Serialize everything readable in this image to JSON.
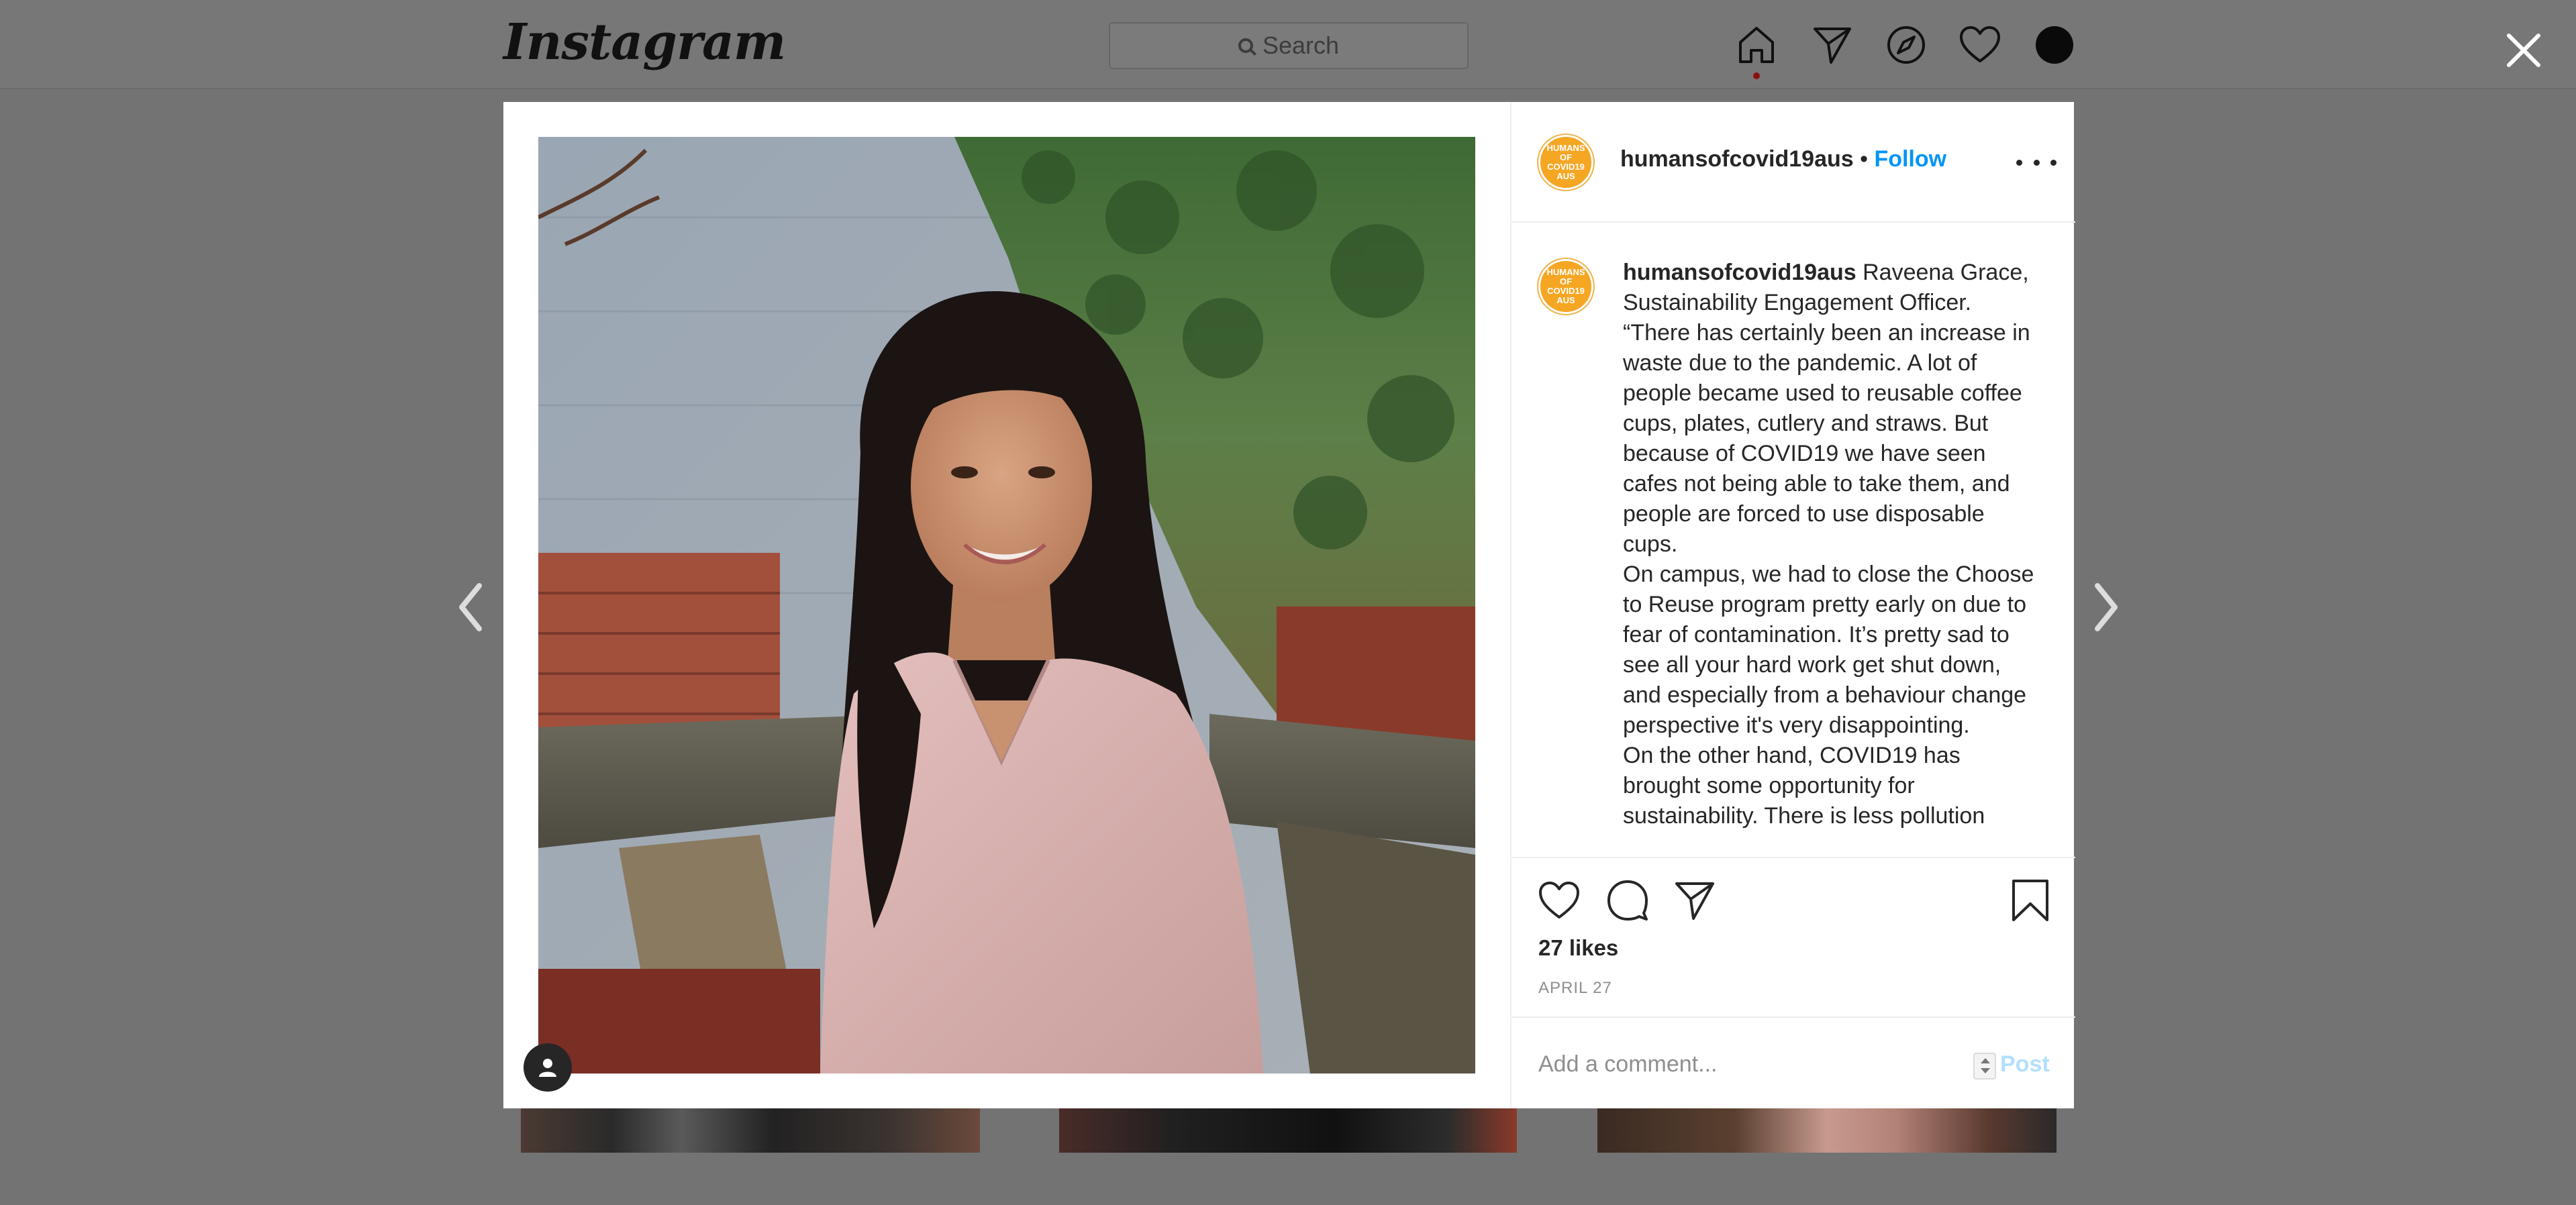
{
  "app": {
    "logo_text": "Instagram"
  },
  "topbar": {
    "search_placeholder": "Search"
  },
  "post": {
    "username": "humansofcovid19aus",
    "separator": " • ",
    "follow_label": "Follow",
    "avatar_text": [
      "HUMANS OF",
      "COVID19",
      "AUS"
    ],
    "caption_paragraphs": [
      "Raveena Grace, Sustainability Engagement Officer. “There has certainly been an increase in waste due to the pandemic. A lot of people became used to reusable coffee cups, plates, cutlery and straws. But because of COVID19 we have seen cafes not being able to take them, and people are forced to use disposable cups.",
      "On campus, we had to close the Choose to Reuse program pretty early on due to fear of contamination. It’s pretty sad to see all your hard work get shut down, and especially from a behaviour change perspective it's very disappointing.",
      "On the other hand, COVID19 has brought some opportunity for sustainability. There is less pollution"
    ],
    "likes": "27 likes",
    "date": "APRIL 27"
  },
  "comment": {
    "placeholder": "Add a comment...",
    "post_label": "Post"
  },
  "colors": {
    "accent": "#0095f6",
    "post_disabled": "#b2dffc",
    "brand_orange": "#f5a623"
  },
  "icons": [
    "home-icon",
    "direct-icon",
    "explore-icon",
    "heart-icon",
    "close-icon",
    "chevron-left-icon",
    "chevron-right-icon",
    "like-icon",
    "comment-icon",
    "share-icon",
    "bookmark-icon",
    "more-icon",
    "tag-user-icon"
  ]
}
